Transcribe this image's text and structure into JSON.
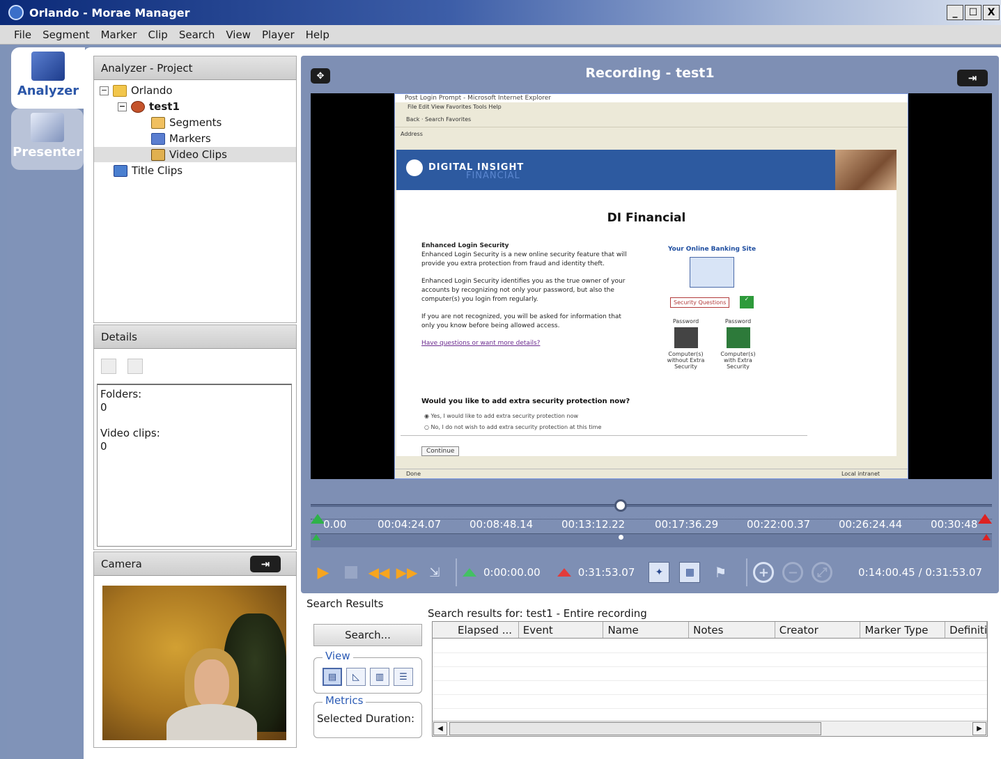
{
  "window": {
    "title": "Orlando - Morae Manager",
    "min": "_",
    "max": "☐",
    "close": "X"
  },
  "menu": [
    "File",
    "Segment",
    "Marker",
    "Clip",
    "Search",
    "View",
    "Player",
    "Help"
  ],
  "modes": {
    "analyzer": "Analyzer",
    "presenter": "Presenter"
  },
  "project": {
    "title": "Analyzer - Project",
    "tree": {
      "root": "Orlando",
      "recording": "test1",
      "segments": "Segments",
      "markers": "Markers",
      "video_clips": "Video Clips",
      "title_clips": "Title Clips"
    }
  },
  "details": {
    "title": "Details",
    "folders_label": "Folders:",
    "folders_value": "0",
    "video_clips_label": "Video clips:",
    "video_clips_value": "0"
  },
  "camera": {
    "title": "Camera"
  },
  "recording": {
    "title": "Recording - test1",
    "captured_page": {
      "window_title": "Post Login Prompt - Microsoft Internet Explorer",
      "menu": "File  Edit  View  Favorites  Tools  Help",
      "toolbar": "Back  ·  Search  Favorites",
      "address": "Address",
      "brand": "DIGITAL INSIGHT",
      "brand_sub": "FINANCIAL",
      "heading": "DI Financial",
      "section_title": "Enhanced Login Security",
      "para1": "Enhanced Login Security is a new online security feature that will provide you extra protection from fraud and identity theft.",
      "para2": "Enhanced Login Security identifies you as the true owner of your accounts by recognizing not only your password, but also the computer(s) you login from regularly.",
      "para3": "If you are not recognized, you will be asked for information that only you know before being allowed access.",
      "link": "Have questions or want more details?",
      "diagram_title": "Your Online Banking Site",
      "security_questions": "Security Questions",
      "password_left": "Password",
      "password_right": "Password",
      "computer_without": "Computer(s) without Extra Security",
      "computer_with": "Computer(s) with Extra Security",
      "question": "Would you like to add extra security protection now?",
      "option_yes": "Yes, I would like to add extra security protection now",
      "option_no": "No, I do not wish to add extra security protection at this time",
      "continue": "Continue",
      "status": "Done",
      "zone": "Local intranet"
    }
  },
  "timeline": {
    "ticks": [
      "0.00",
      "00:04:24.07",
      "00:08:48.14",
      "00:13:12.22",
      "00:17:36.29",
      "00:22:00.37",
      "00:26:24.44",
      "00:30:48"
    ],
    "playhead_fraction": 0.455
  },
  "player": {
    "start_time": "0:00:00.00",
    "end_time": "0:31:53.07",
    "position": "0:14:00.45 / 0:31:53.07"
  },
  "search": {
    "panel_label": "Search Results",
    "results_for": "Search results for: test1 - Entire recording",
    "search_button": "Search...",
    "view_legend": "View",
    "metrics_legend": "Metrics",
    "selected_duration": "Selected Duration:",
    "columns": [
      "Elapsed ...",
      "Event",
      "Name",
      "Notes",
      "Creator",
      "Marker Type",
      "Definiti"
    ]
  },
  "colors": {
    "title_gradient_start": "#0b2a78",
    "workspace_blue": "#7e8fb4",
    "start_marker": "#2fb24a",
    "end_marker": "#d22222",
    "play_orange": "#f7a51f",
    "analyzer_text": "#2b56a8"
  }
}
